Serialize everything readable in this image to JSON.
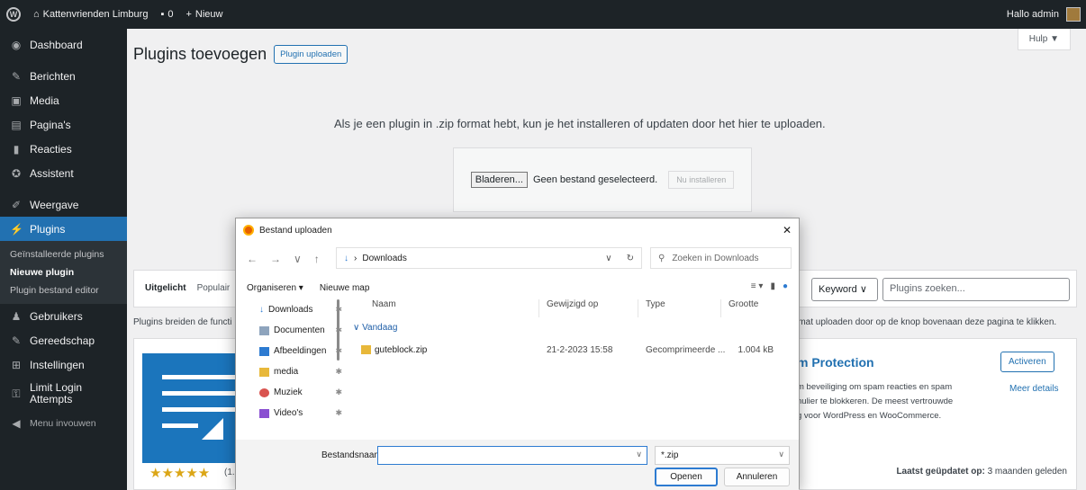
{
  "adminbar": {
    "site_name": "Kattenvrienden Limburg",
    "comments_count": "0",
    "new_label": "Nieuw",
    "greeting": "Hallo admin"
  },
  "sidebar": {
    "items": [
      {
        "label": "Dashboard",
        "icon": "dashboard-icon"
      },
      {
        "label": "Berichten",
        "icon": "pin-icon"
      },
      {
        "label": "Media",
        "icon": "media-icon"
      },
      {
        "label": "Pagina's",
        "icon": "page-icon"
      },
      {
        "label": "Reacties",
        "icon": "comment-icon"
      },
      {
        "label": "Assistent",
        "icon": "assistant-icon"
      },
      {
        "label": "Weergave",
        "icon": "brush-icon"
      },
      {
        "label": "Plugins",
        "icon": "plugin-icon"
      },
      {
        "label": "Gebruikers",
        "icon": "users-icon"
      },
      {
        "label": "Gereedschap",
        "icon": "wrench-icon"
      },
      {
        "label": "Instellingen",
        "icon": "settings-icon"
      },
      {
        "label": "Limit Login Attempts",
        "icon": "lock-icon"
      },
      {
        "label": "Menu invouwen",
        "icon": "collapse-icon"
      }
    ],
    "plugins_submenu": [
      "Geïnstalleerde plugins",
      "Nieuwe plugin",
      "Plugin bestand editor"
    ]
  },
  "page": {
    "title": "Plugins toevoegen",
    "upload_button": "Plugin uploaden",
    "help_tab": "Hulp ▼",
    "upload_message": "Als je een plugin in .zip format hebt, kun je het installeren of updaten door het hier te uploaden.",
    "browse_button": "Bladeren...",
    "no_file": "Geen bestand geselecteerd.",
    "install_button": "Nu installeren"
  },
  "filter": {
    "tabs": [
      "Uitgelicht",
      "Populair"
    ],
    "keyword_select": "Keyword ∨",
    "search_placeholder": "Plugins zoeken..."
  },
  "intro": {
    "left": "Plugins breiden de functi",
    "right": "rmat uploaden door op de knop bovenaan deze pagina te klikken."
  },
  "plugin_card": {
    "title": "m Protection",
    "description": "m beveiliging om spam reacties en spam\nnulier te blokkeren. De meest vertrouwde\ng voor WordPress en WooCommerce.",
    "activate_button": "Activeren",
    "details_link": "Meer details",
    "rating_stars": 5,
    "rating_count": "(1.",
    "last_updated_label": "Laatst geüpdatet op:",
    "last_updated_value": "3 maanden geleden"
  },
  "dialog": {
    "title": "Bestand uploaden",
    "path": "Downloads",
    "search_placeholder": "Zoeken in Downloads",
    "organize": "Organiseren ▾",
    "new_folder": "Nieuwe map",
    "nav_items": [
      {
        "label": "Downloads",
        "icon": "download-icon"
      },
      {
        "label": "Documenten",
        "icon": "document-icon"
      },
      {
        "label": "Afbeeldingen",
        "icon": "image-icon"
      },
      {
        "label": "media",
        "icon": "folder-icon"
      },
      {
        "label": "Muziek",
        "icon": "music-icon"
      },
      {
        "label": "Video's",
        "icon": "video-icon"
      }
    ],
    "columns": [
      "Naam",
      "Gewijzigd op",
      "Type",
      "Grootte"
    ],
    "group": "Vandaag",
    "files": [
      {
        "name": "guteblock.zip",
        "modified": "21-2-2023 15:58",
        "type": "Gecomprimeerde ...",
        "size": "1.004 kB"
      }
    ],
    "filename_label": "Bestandsnaam:",
    "filename_value": "",
    "filetype": "*.zip",
    "open_button": "Openen",
    "cancel_button": "Annuleren"
  },
  "colors": {
    "wp_dark": "#1d2327",
    "wp_blue": "#2271b1",
    "content_bg": "#f0f0f1",
    "plugin_icon_bg": "#1b75bc"
  }
}
